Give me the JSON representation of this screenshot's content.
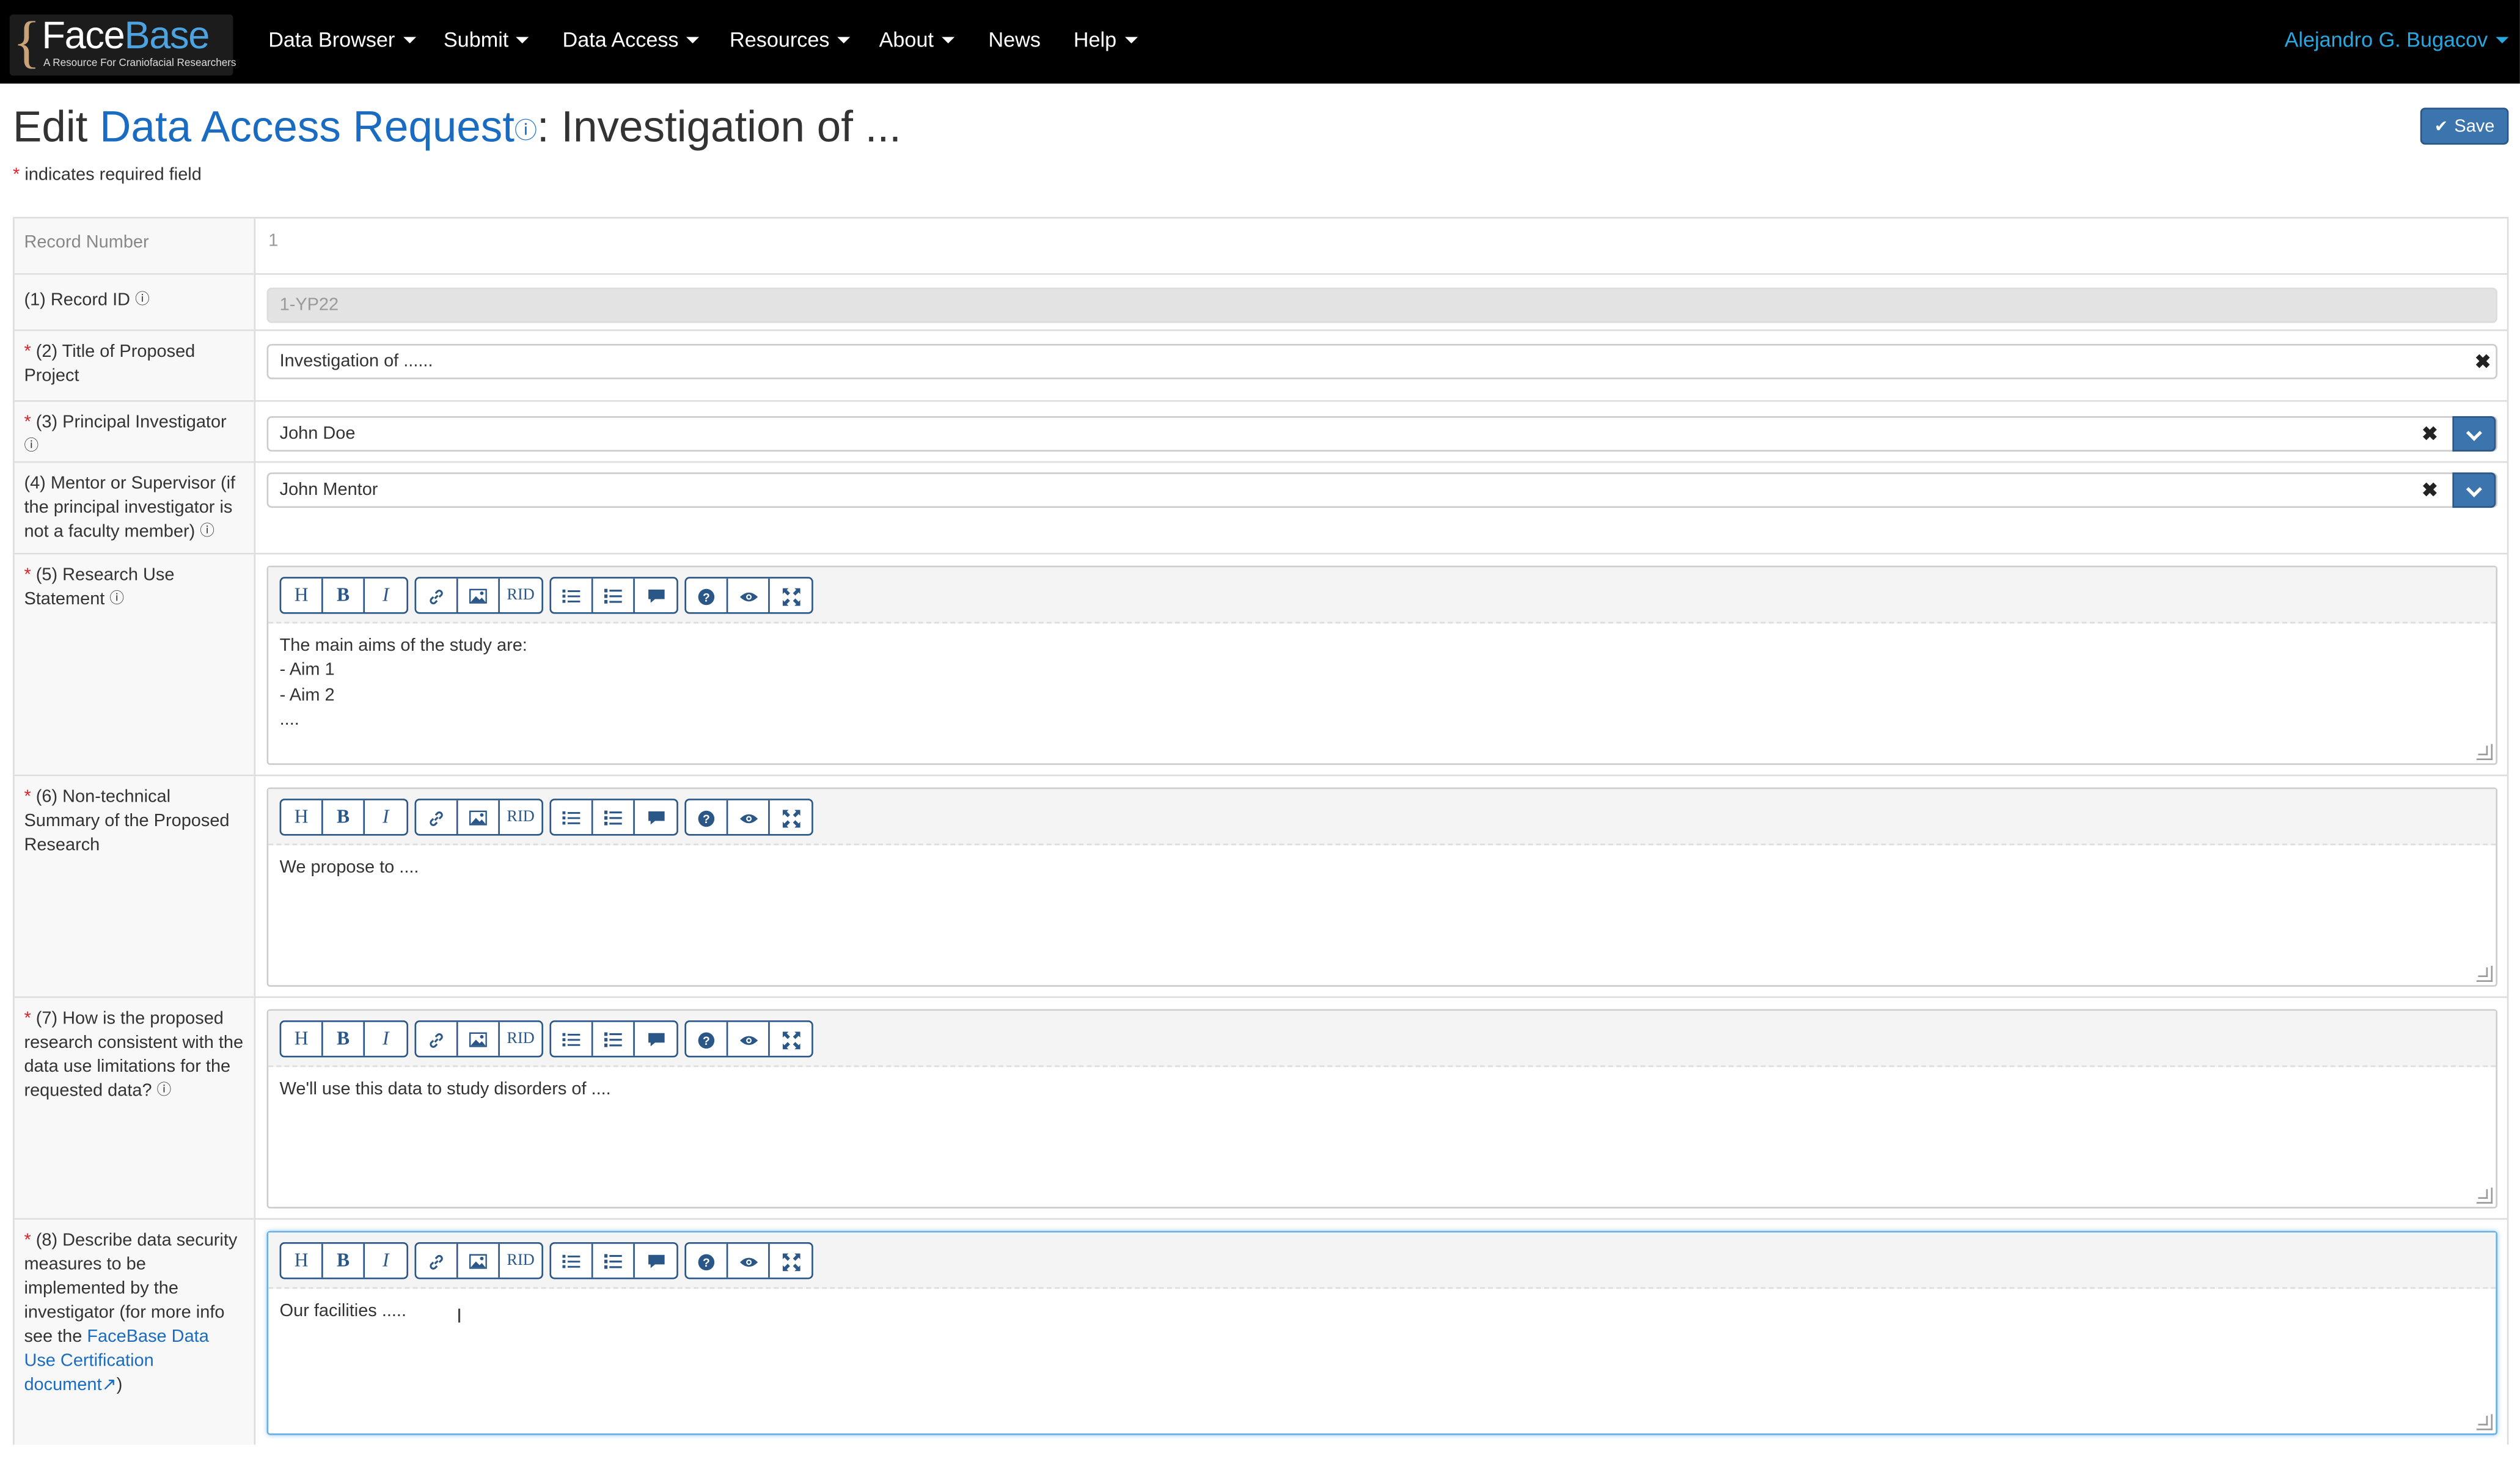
{
  "nav": {
    "logo_face": "Face",
    "logo_base": "Base",
    "logo_tagline": "A Resource For Craniofacial Researchers",
    "items": [
      "Data Browser",
      "Submit",
      "Data Access",
      "Resources",
      "About",
      "News",
      "Help"
    ],
    "user": "Alejandro G. Bugacov"
  },
  "title": {
    "prefix": "Edit ",
    "link": "Data Access Request",
    "suffix": ": Investigation of ...",
    "required_note": "indicates required field",
    "save": "Save"
  },
  "fields": {
    "record_number": {
      "label": "Record Number",
      "value": "1"
    },
    "record_id": {
      "label": "(1) Record ID",
      "value": "1-YP22"
    },
    "title": {
      "label": "(2) Title of Proposed Project",
      "value": "Investigation of ......"
    },
    "pi": {
      "label": "(3) Principal Investigator",
      "value": "John Doe"
    },
    "mentor": {
      "label": "(4) Mentor or Supervisor (if the principal investigator is not a faculty member)",
      "value": "John Mentor"
    },
    "research_use": {
      "label": "(5) Research Use Statement",
      "value": "The main aims of the study are:\n- Aim 1\n- Aim 2\n...."
    },
    "summary": {
      "label": "(6) Non-technical Summary of the Proposed Research",
      "value": "We propose to ...."
    },
    "consistency": {
      "label": "(7) How is the proposed research consistent with the data use limitations for the requested data?",
      "value": "We'll use this data to study disorders of ...."
    },
    "security": {
      "label_pre": "(8) Describe data security measures to be implemented by the investigator (for more info see the ",
      "label_link": "FaceBase Data Use Certification document",
      "label_post": ")",
      "value": "Our facilities ....."
    }
  },
  "toolbar": {
    "heading": "H",
    "bold": "B",
    "italic": "I",
    "rid": "RID"
  },
  "colors": {
    "accent": "#3c74ad",
    "link": "#1a6cc2",
    "required": "#d9242b",
    "user": "#29a7e1"
  }
}
